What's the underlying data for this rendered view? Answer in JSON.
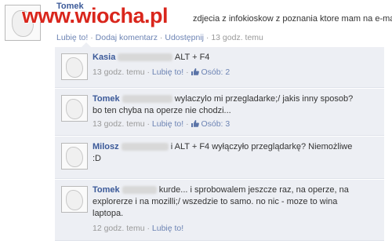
{
  "watermark": "www.wiocha.pl",
  "post": {
    "author": "Tomek",
    "text": "zdjecia z infokioskow z poznania ktore mam na e-mailu?",
    "meta": {
      "like": "Lubię to!",
      "comment": "Dodaj komentarz",
      "share": "Udostępnij",
      "time": "13 godz. temu"
    }
  },
  "comments": [
    {
      "author": "Kasia",
      "text": "ALT + F4",
      "time": "13 godz. temu",
      "like": "Lubię to!",
      "count": "Osób: 2"
    },
    {
      "author": "Tomek",
      "text": "wylaczylo mi przegladarke;/ jakis inny sposob? bo ten chyba na operze nie chodzi...",
      "time": "13 godz. temu",
      "like": "Lubię to!",
      "count": "Osób: 3"
    },
    {
      "author": "Milosz",
      "text": "i ALT + F4 wyłączyło przeglądarkę? Niemożliwe :D",
      "time": "",
      "like": "",
      "count": ""
    },
    {
      "author": "Tomek",
      "text": "kurde... i sprobowalem jeszcze raz, na operze, na explorerze i na mozilli;/ wszedzie to samo. no nic - moze to wina laptopa.",
      "time": "12 godz. temu",
      "like": "Lubię to!",
      "count": ""
    }
  ],
  "colors": {
    "link": "#3b5998",
    "comment_bg": "#edeff4",
    "watermark": "#d9261c"
  }
}
